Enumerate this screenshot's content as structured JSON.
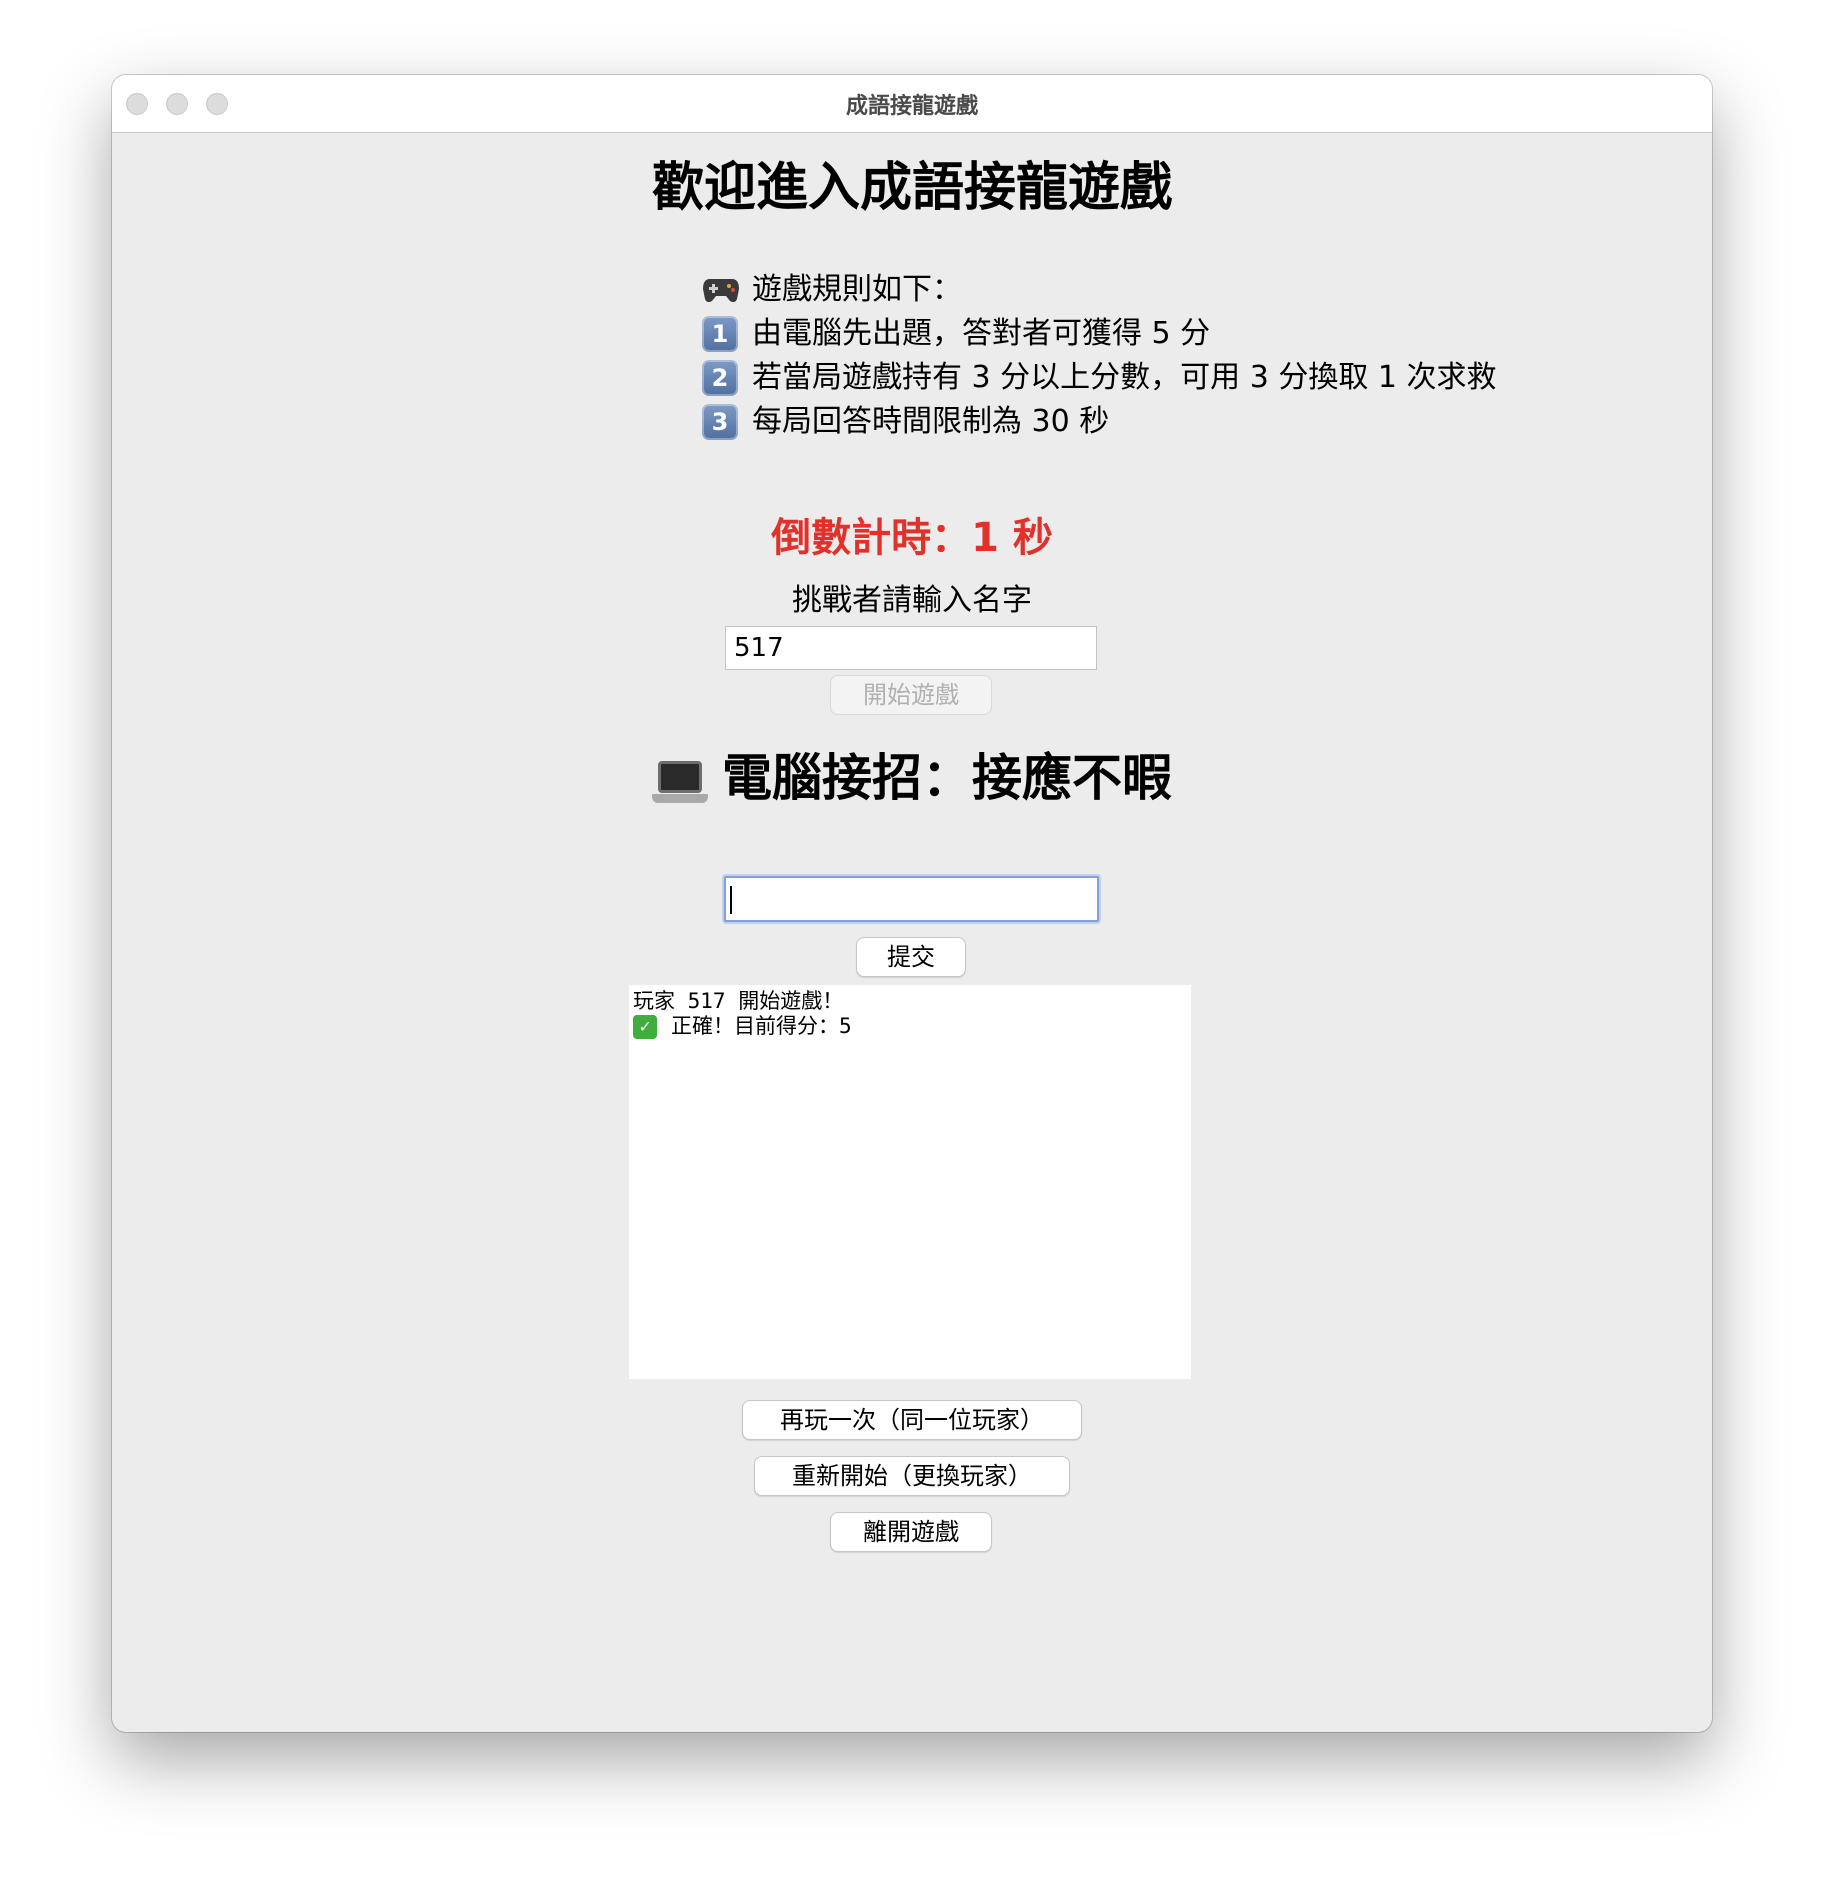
{
  "window": {
    "title": "成語接龍遊戲"
  },
  "main": {
    "heading": "歡迎進入成語接龍遊戲",
    "rules": {
      "intro_icon": "game-controller-icon",
      "intro": "遊戲規則如下：",
      "items": [
        {
          "number": "1",
          "text": "由電腦先出題，答對者可獲得 5 分"
        },
        {
          "number": "2",
          "text": "若當局遊戲持有 3 分以上分數，可用 3 分換取 1 次求救"
        },
        {
          "number": "3",
          "text": "每局回答時間限制為 30 秒"
        }
      ]
    },
    "countdown": "倒數計時：1 秒",
    "countdown_color": "#e0312a",
    "name_prompt": "挑戰者請輸入名字",
    "name_value": "517",
    "start_button": "開始遊戲",
    "computer_icon": "laptop-icon",
    "computer_move": "電腦接招：接應不暇",
    "answer_value": "",
    "submit_button": "提交",
    "log": {
      "lines": [
        {
          "icon": "",
          "text": "玩家 517 開始遊戲！"
        },
        {
          "icon": "check-icon",
          "text": "正確！目前得分：5"
        }
      ]
    },
    "replay_button": "再玩一次（同一位玩家）",
    "restart_button": "重新開始（更換玩家）",
    "exit_button": "離開遊戲"
  }
}
